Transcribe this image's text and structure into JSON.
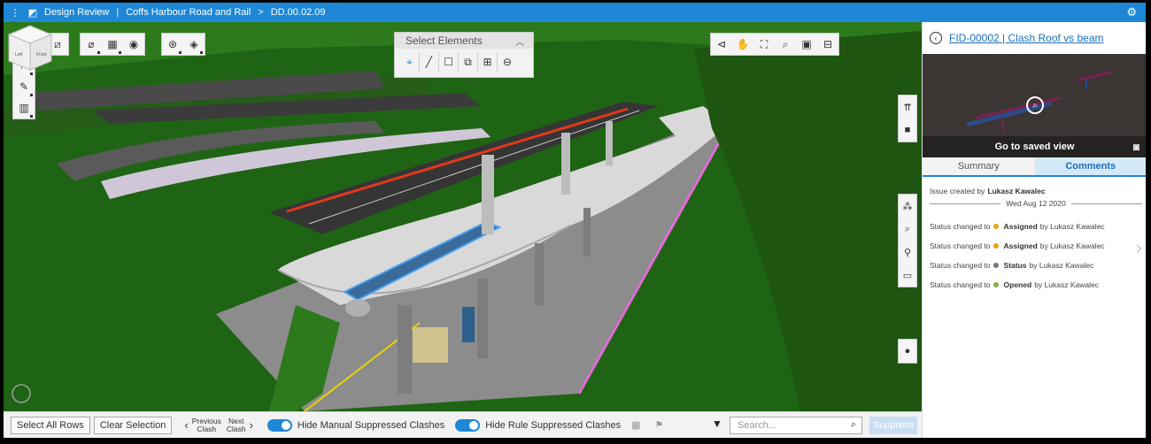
{
  "topbar": {
    "menu_icon": "menu-icon",
    "app_icon": "app-logo-icon",
    "app_name": "Design Review",
    "project": "Coffs Harbour Road and Rail",
    "chevron": ">",
    "document": "DD.00.02.09",
    "settings_icon": "gear-icon"
  },
  "toolbar": {
    "left_tools": [
      "select-arrow-icon",
      "flag-icon",
      "measure-icon",
      "section-icon"
    ],
    "group1": [
      "fit-icon"
    ],
    "group2": [
      "hide-icon",
      "isolate-icon",
      "visibility-icon"
    ],
    "group3": [
      "model-tree-icon",
      "layers-icon"
    ],
    "nav_tools": [
      "pan-arrow-icon",
      "hand-icon",
      "fit-view-icon",
      "zoom-icon",
      "window-icon",
      "minimize-icon"
    ]
  },
  "select_panel": {
    "title": "Select Elements",
    "tools": [
      "point-select-icon",
      "line-select-icon",
      "box-select-icon",
      "multi-select-icon",
      "add-icon",
      "subtract-icon"
    ]
  },
  "view_cube": {
    "left_face": "Left",
    "front_face": "Front"
  },
  "side_tools_top": [
    "walk-icon",
    "camera-icon"
  ],
  "side_tools_mid": [
    "tree-icon",
    "search-icon",
    "issue-icon",
    "viewpoint-icon"
  ],
  "side_tools_bottom": [
    "info-icon"
  ],
  "issue": {
    "back_icon": "back-circle-icon",
    "title": "FID-00002 | Clash Roof vs beam",
    "goto_label": "Go to saved view",
    "camera_icon": "camera-icon",
    "tabs": [
      "Summary",
      "Comments"
    ],
    "active_tab": "Comments",
    "created_prefix": "Issue created by",
    "created_by": "Lukasz Kawalec",
    "date": "Wed Aug 12 2020",
    "events": [
      {
        "prefix": "Status changed to",
        "status": "Assigned",
        "by": "by Lukasz Kawalec",
        "color": "#e8a317"
      },
      {
        "prefix": "Status changed to",
        "status": "Assigned",
        "by": "by Lukasz Kawalec",
        "color": "#e8a317"
      },
      {
        "prefix": "Status changed to",
        "status": "Status",
        "by": "by Lukasz Kawalec",
        "color": "#777777"
      },
      {
        "prefix": "Status changed to",
        "status": "Opened",
        "by": "by Lukasz Kawalec",
        "color": "#7cb342"
      }
    ]
  },
  "bottom": {
    "select_all": "Select All Rows",
    "clear": "Clear Selection",
    "prev_1": "Previous",
    "prev_2": "Clash",
    "next_1": "Next",
    "next_2": "Clash",
    "toggle1_label": "Hide Manual Suppressed Clashes",
    "toggle2_label": "Hide Rule Suppressed Clashes",
    "search_placeholder": "Search...",
    "suppress": "Suppress"
  },
  "colors": {
    "accent": "#1e88d6",
    "grass": "#1f5e12",
    "road": "#3b3b3b"
  }
}
